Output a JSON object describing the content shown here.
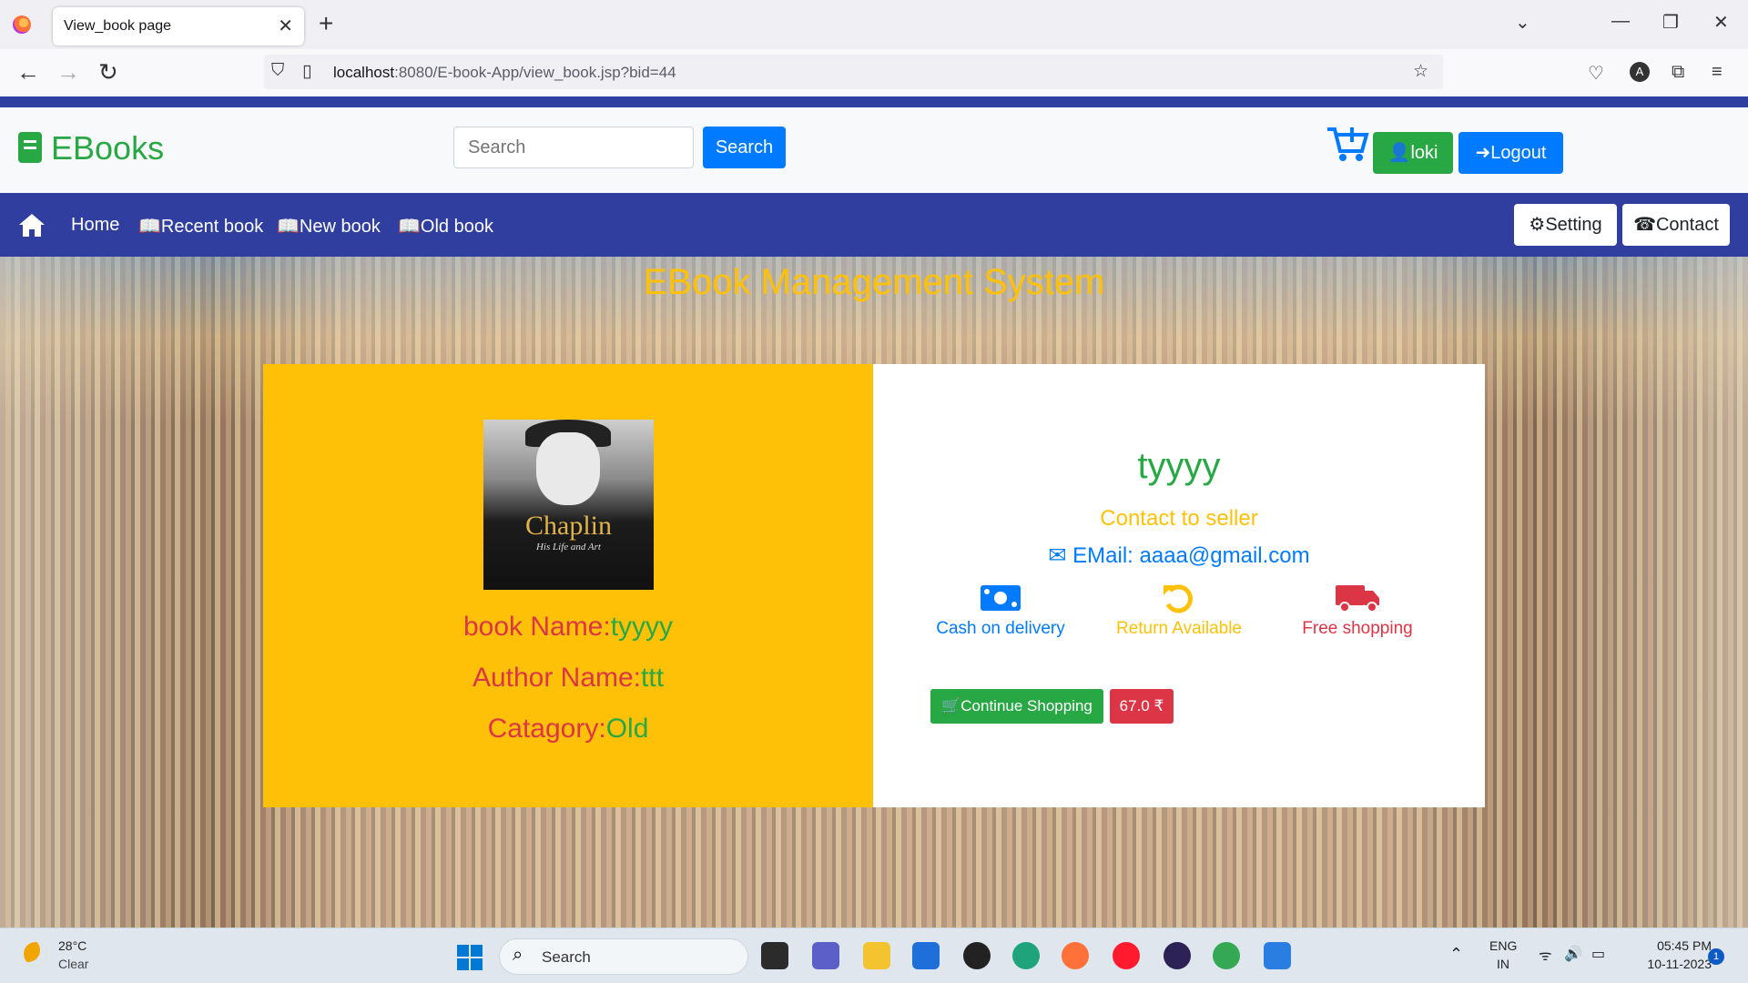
{
  "browser": {
    "tab_title": "View_book page",
    "url_host": "localhost",
    "url_rest": ":8080/E-book-App/view_book.jsp?bid=44"
  },
  "header": {
    "brand": "EBooks",
    "search_placeholder": "Search",
    "search_button": "Search",
    "user_button": "loki",
    "logout_button": "Logout"
  },
  "nav": {
    "items": [
      {
        "label": "Home"
      },
      {
        "label": "Recent book"
      },
      {
        "label": "New book"
      },
      {
        "label": "Old book"
      }
    ],
    "setting": "Setting",
    "contact": "Contact"
  },
  "page": {
    "site_title": "EBook Management System"
  },
  "book": {
    "cover_title": "Chaplin",
    "cover_subtitle": "His Life and Art",
    "name_label": "book Name:",
    "name_value": "tyyyy",
    "author_label": "Author Name:",
    "author_value": "ttt",
    "category_label": "Catagory:",
    "category_value": "Old"
  },
  "seller": {
    "title": "tyyyy",
    "contact": "Contact to seller",
    "email": "EMail: aaaa@gmail.com",
    "features": [
      {
        "label": "Cash on delivery",
        "color": "#007bff",
        "icon": "money-icon"
      },
      {
        "label": "Return Available",
        "color": "#ffc107",
        "icon": "undo-icon"
      },
      {
        "label": "Free shopping",
        "color": "#dc3545",
        "icon": "truck-icon"
      }
    ],
    "continue_button": "Continue Shopping",
    "price": "67.0 ₹"
  },
  "taskbar": {
    "temp": "28°C",
    "weather": "Clear",
    "search": "Search",
    "lang1": "ENG",
    "lang2": "IN",
    "time": "05:45 PM",
    "date": "10-11-2023",
    "notif": "1"
  },
  "colors": {
    "primary": "#007bff",
    "success": "#28a745",
    "warning": "#ffc107",
    "danger": "#dc3545",
    "nav": "#303f9f"
  }
}
